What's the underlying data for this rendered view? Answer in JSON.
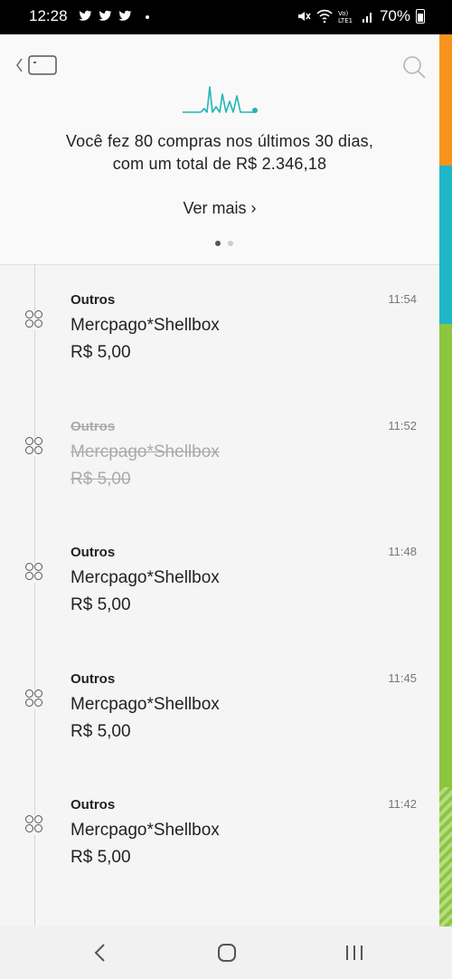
{
  "status_bar": {
    "time": "12:28",
    "icons": [
      "twitter-icon",
      "twitter-icon",
      "twitter-icon",
      "mute-icon",
      "wifi-icon",
      "volte-icon",
      "signal-icon",
      "battery-icon"
    ],
    "battery": "70%"
  },
  "header": {
    "summary_line1": "Você fez 80 compras nos últimos 30 dias,",
    "summary_line2": "com um total de R$ 2.346,18",
    "see_more": "Ver mais ›",
    "pages": 2,
    "active_page": 1
  },
  "transactions": [
    {
      "category": "Outros",
      "merchant": "Mercpago*Shellbox",
      "amount": "R$ 5,00",
      "time": "11:54",
      "canceled": false
    },
    {
      "category": "Outros",
      "merchant": "Mercpago*Shellbox",
      "amount": "R$ 5,00",
      "time": "11:52",
      "canceled": true
    },
    {
      "category": "Outros",
      "merchant": "Mercpago*Shellbox",
      "amount": "R$ 5,00",
      "time": "11:48",
      "canceled": false
    },
    {
      "category": "Outros",
      "merchant": "Mercpago*Shellbox",
      "amount": "R$ 5,00",
      "time": "11:45",
      "canceled": false
    },
    {
      "category": "Outros",
      "merchant": "Mercpago*Shellbox",
      "amount": "R$ 5,00",
      "time": "11:42",
      "canceled": false
    }
  ],
  "colors": {
    "accent": "#21b5b5",
    "strip_orange": "#f7941d",
    "strip_teal": "#1fb6c8",
    "strip_green": "#8cc63f"
  }
}
